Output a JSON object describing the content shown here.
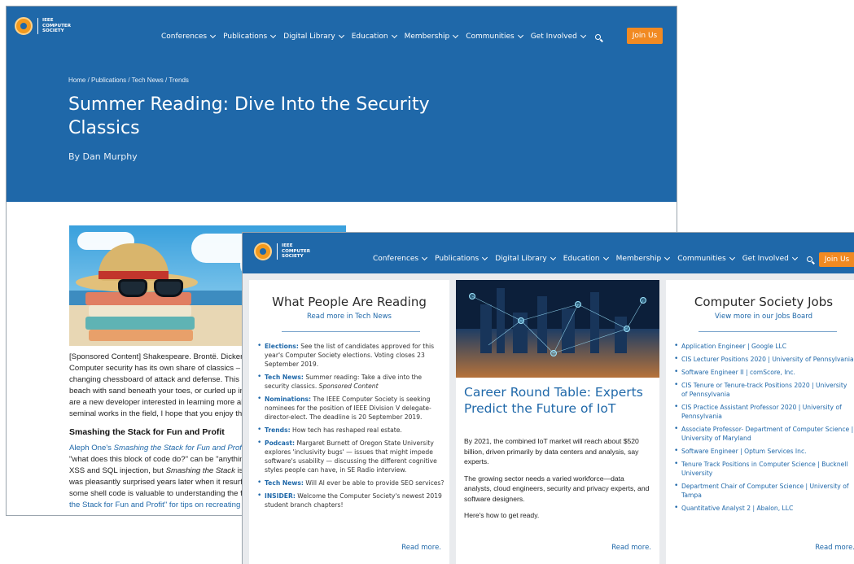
{
  "logo": {
    "line1": "IEEE",
    "line2": "COMPUTER",
    "line3": "SOCIETY"
  },
  "nav": {
    "items": [
      "Conferences",
      "Publications",
      "Digital Library",
      "Education",
      "Membership",
      "Communities",
      "Get Involved"
    ],
    "join_label": "Join Us"
  },
  "article": {
    "breadcrumb": "Home / Publications / Tech News / Trends",
    "title": "Summer Reading: Dive Into the Security Classics",
    "byline": "By Dan Murphy",
    "paragraph_lines": [
      "[Sponsored Content] Shakespeare. Brontë. Dickens.",
      "Computer security has its own share of classics – ref",
      "changing chessboard of attack and defense. This list",
      "beach with sand beneath your toes, or curled up in be",
      "are a new developer interested in learning more abou",
      "seminal works in the field, I hope that you enjoy the a"
    ],
    "section_heading": "Smashing the Stack for Fun and Profit",
    "section_lines": [
      {
        "pre": "",
        "link": "Aleph One's ",
        "linkItal": "Smashing the Stack for Fun and Profit",
        "post": " w"
      },
      {
        "pre": "\"what does this block of code do?\" can be \"anything t",
        "link": "",
        "linkItal": "",
        "post": ""
      },
      {
        "pre": "XSS and SQL injection, but ",
        "link": "",
        "linkItal": "",
        "italic": "Smashing the Stack",
        "post": " is th"
      },
      {
        "pre": "was pleasantly surprised years later when it resurface",
        "link": "",
        "linkItal": "",
        "post": ""
      },
      {
        "pre": "some shell code is valuable to understanding the fun",
        "link": "",
        "linkItal": "",
        "post": ""
      },
      {
        "pre": "",
        "link": "the Stack for Fun and Profit\" for tips on recreating the",
        "linkItal": "",
        "post": ""
      }
    ]
  },
  "reading": {
    "title": "What People Are Reading",
    "subtitle": "Read more in Tech News",
    "items": [
      {
        "label": "Elections:",
        "text": " See the list of candidates approved for this year's Computer Society elections. Voting closes 23 September 2019."
      },
      {
        "label": "Tech News:",
        "text": " Summer reading: Take a dive into the security classics. ",
        "italic": "Sponsored Content"
      },
      {
        "label": "Nominations:",
        "text": " The IEEE Computer Society is seeking nominees for the position of IEEE Division V delegate-director-elect. The deadline is 20 September 2019."
      },
      {
        "label": "Trends:",
        "text": " How tech has reshaped real estate."
      },
      {
        "label": "Podcast:",
        "text": " Margaret Burnett of Oregon State University explores 'inclusivity bugs' — issues that might impede software's usability — discussing the different cognitive styles people can have, in SE Radio interview."
      },
      {
        "label": "Tech News:",
        "text": " Will AI ever be able to provide SEO services?"
      },
      {
        "label": "INSIDER:",
        "text": " Welcome the Computer Society's newest 2019 student branch chapters!"
      }
    ],
    "read_more": "Read more."
  },
  "iot": {
    "title": "Career Round Table: Experts Predict the Future of IoT",
    "paragraphs": [
      "By 2021, the combined IoT market will reach about $520 billion, driven primarily by data centers and analysis, say experts.",
      "The growing sector needs a varied workforce—data analysts, cloud engineers, security and privacy experts, and software designers.",
      "Here's how to get ready."
    ],
    "read_more": "Read more."
  },
  "jobs": {
    "title": "Computer Society Jobs",
    "subtitle": "View more in our Jobs Board",
    "items": [
      "Application Engineer | Google LLC",
      "CIS Lecturer Positions 2020 | University of Pennsylvania",
      "Software Engineer II | comScore, Inc.",
      "CIS Tenure or Tenure-track Positions 2020 | University of Pennsylvania",
      "CIS Practice Assistant Professor 2020 | University of Pennsylvania",
      "Associate Professor- Department of Computer Science | University of Maryland",
      "Software Engineer | Optum Services Inc.",
      "Tenure Track Positions in Computer Science | Bucknell University",
      "Department Chair of Computer Science | University of Tampa",
      "Quantitative Analyst 2 | Abalon, LLC"
    ],
    "read_more": "Read more."
  },
  "colors": {
    "brand_blue": "#1f68a9",
    "join_orange": "#f18a22"
  }
}
